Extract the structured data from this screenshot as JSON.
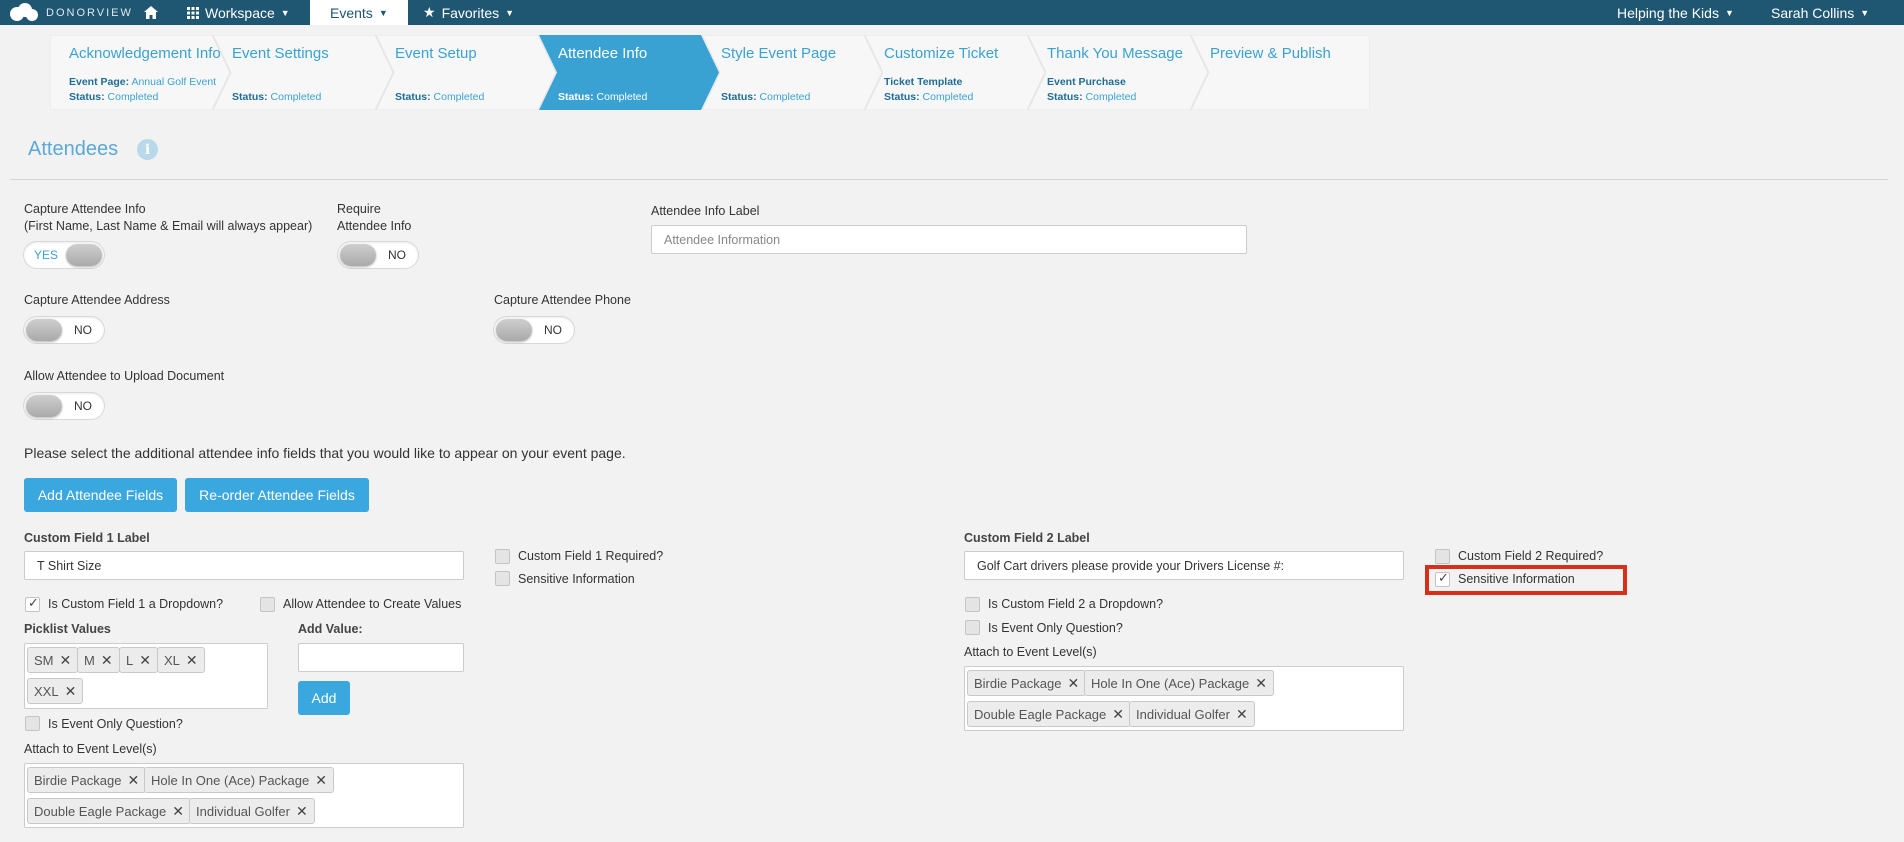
{
  "nav": {
    "brand": "DONORVIEW",
    "workspace": "Workspace",
    "events": "Events",
    "favorites": "Favorites",
    "org": "Helping the Kids",
    "user": "Sarah Collins"
  },
  "steps": [
    {
      "title": "Acknowledgement Info",
      "line1_key": "Event Page:",
      "line1_val": "Annual Golf Event",
      "status_key": "Status:",
      "status_val": "Completed"
    },
    {
      "title": "Event Settings",
      "status_key": "Status:",
      "status_val": "Completed"
    },
    {
      "title": "Event Setup",
      "status_key": "Status:",
      "status_val": "Completed"
    },
    {
      "title": "Attendee Info",
      "status_key": "Status:",
      "status_val": "Completed",
      "active": true
    },
    {
      "title": "Style Event Page",
      "status_key": "Status:",
      "status_val": "Completed"
    },
    {
      "title": "Customize Ticket",
      "line1_key": "Ticket Template",
      "line1_val": "",
      "status_key": "Status:",
      "status_val": "Completed"
    },
    {
      "title": "Thank You Message",
      "line1_key": "Event Purchase",
      "line1_val": "",
      "status_key": "Status:",
      "status_val": "Completed"
    },
    {
      "title": "Preview & Publish"
    }
  ],
  "section": {
    "title": "Attendees",
    "info_glyph": "i"
  },
  "capture_info": {
    "label1": "Capture Attendee Info",
    "label2": "(First Name, Last Name & Email will always appear)",
    "toggle": "YES"
  },
  "require_info": {
    "label1": "Require",
    "label2": "Attendee Info",
    "toggle": "NO"
  },
  "info_label": {
    "label": "Attendee Info Label",
    "placeholder": "Attendee Information"
  },
  "capture_address": {
    "label": "Capture Attendee Address",
    "toggle": "NO"
  },
  "capture_phone": {
    "label": "Capture Attendee Phone",
    "toggle": "NO"
  },
  "upload_doc": {
    "label": "Allow Attendee to Upload Document",
    "toggle": "NO"
  },
  "instructions": "Please select the additional attendee info fields that you would like to appear on your event page.",
  "buttons": {
    "add_fields": "Add Attendee Fields",
    "reorder_fields": "Re-order Attendee Fields",
    "add": "Add"
  },
  "field1": {
    "label": "Custom Field 1 Label",
    "value": "T Shirt Size",
    "required": "Custom Field 1 Required?",
    "sensitive": "Sensitive Information",
    "dropdown": "Is Custom Field 1 a Dropdown?",
    "allow_create": "Allow Attendee to Create Values",
    "picklist_label": "Picklist Values",
    "picklist": [
      "SM",
      "M",
      "L",
      "XL",
      "XXL"
    ],
    "add_value_label": "Add Value:",
    "event_only": "Is Event Only Question?",
    "attach_label": "Attach to Event Level(s)",
    "levels": [
      "Birdie Package",
      "Hole In One (Ace) Package",
      "Double Eagle Package",
      "Individual Golfer"
    ]
  },
  "field2": {
    "label": "Custom Field 2 Label",
    "value": "Golf Cart drivers please provide your Drivers License #:",
    "required": "Custom Field 2 Required?",
    "sensitive": "Sensitive Information",
    "dropdown": "Is Custom Field 2 a Dropdown?",
    "event_only": "Is Event Only Question?",
    "attach_label": "Attach to Event Level(s)",
    "levels": [
      "Birdie Package",
      "Hole In One (Ace) Package",
      "Double Eagle Package",
      "Individual Golfer"
    ]
  },
  "colors": {
    "nav": "#1f5672",
    "accent": "#3aa8df",
    "highlight": "#d6301b"
  }
}
